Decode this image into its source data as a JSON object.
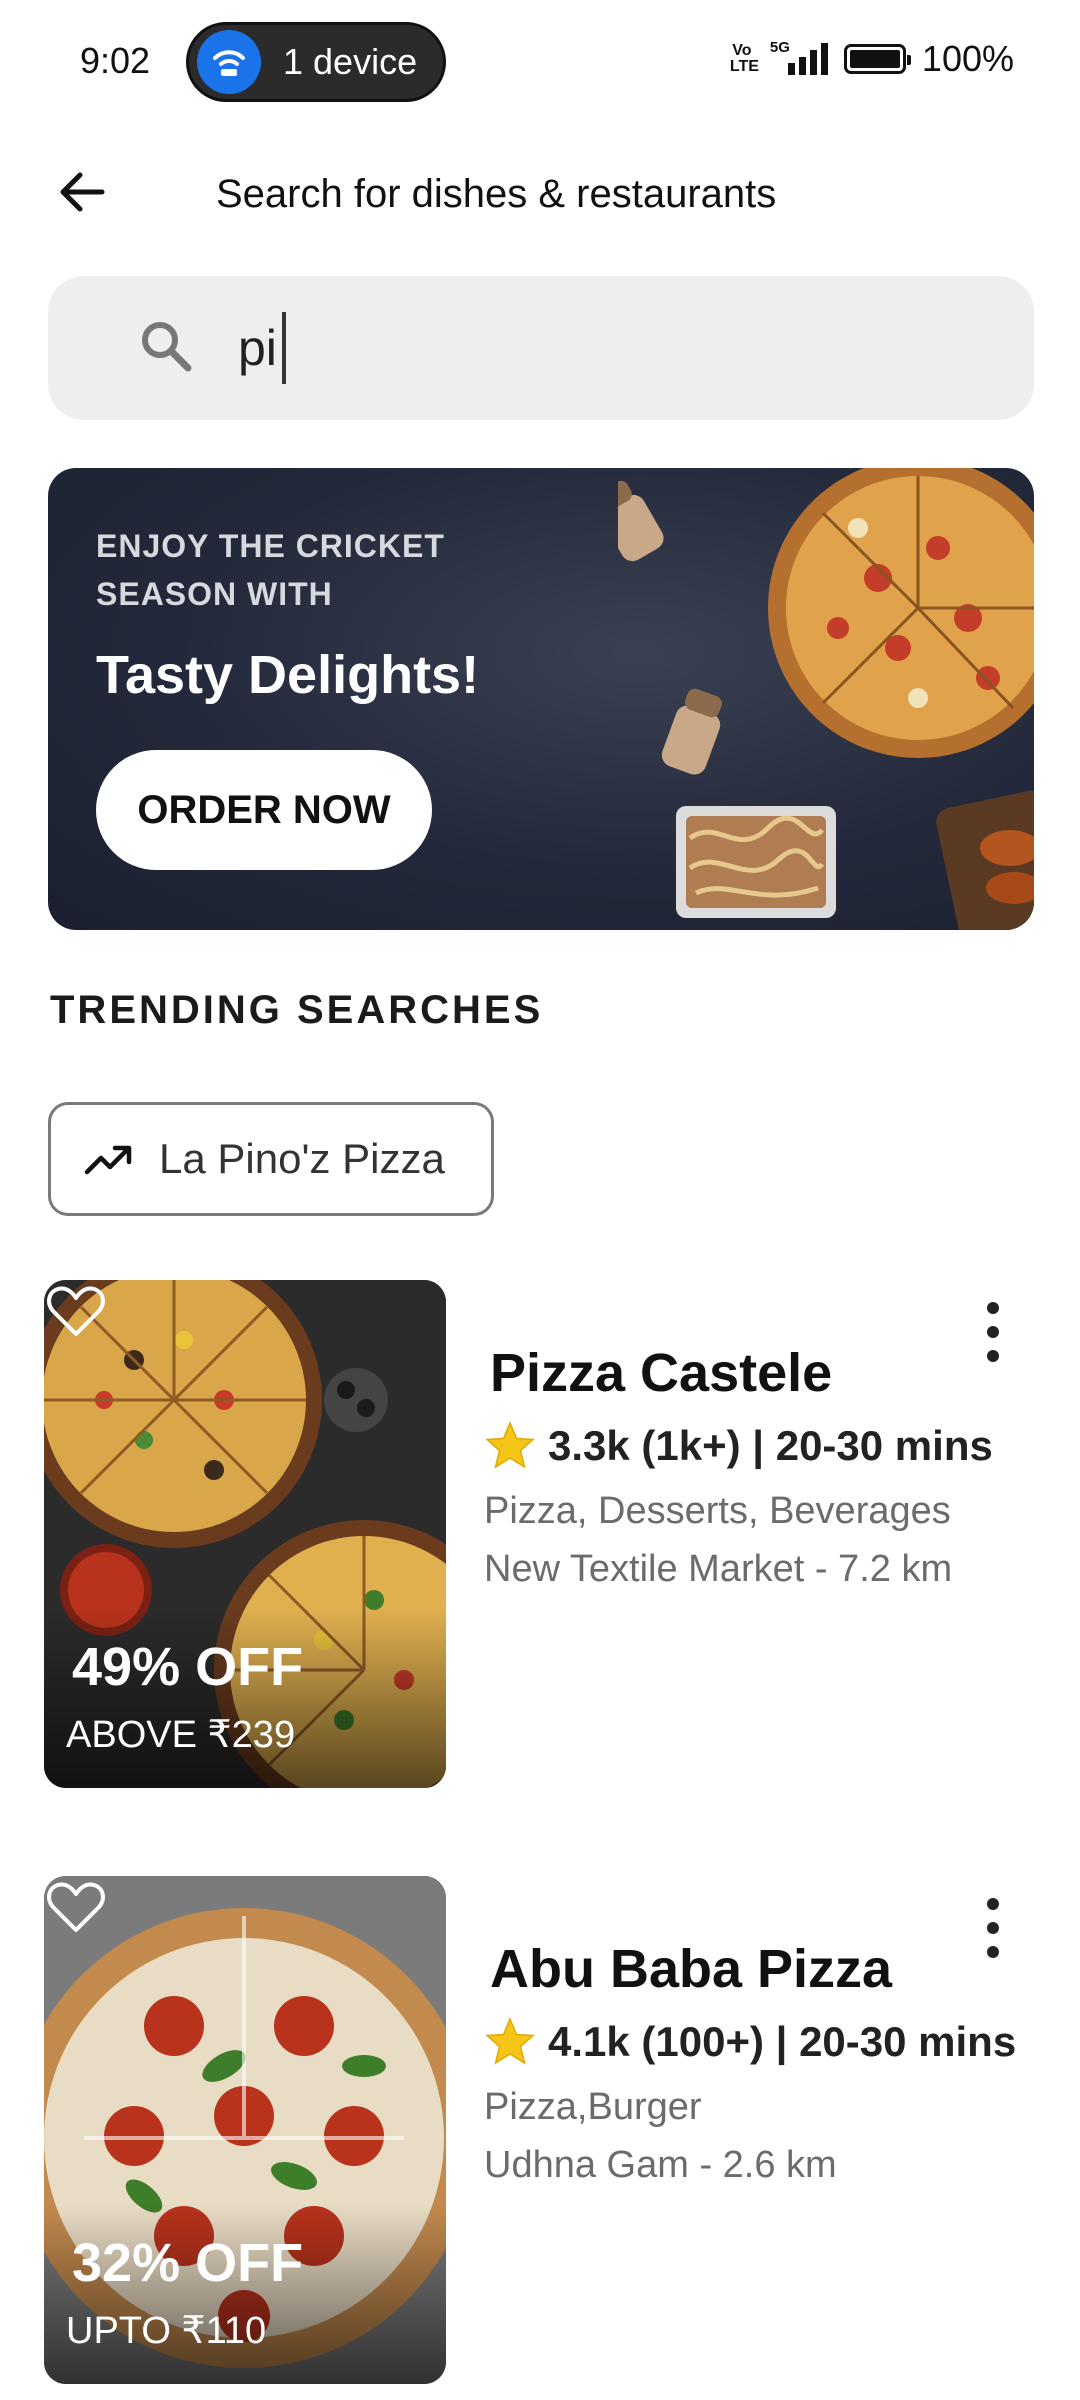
{
  "status_bar": {
    "time": "9:02",
    "device_pill": "1 device",
    "volte": "Vo LTE",
    "network": "5G",
    "battery": "100%"
  },
  "header": {
    "title": "Search for dishes & restaurants"
  },
  "search": {
    "value": "pi"
  },
  "banner": {
    "eyebrow": "ENJOY THE CRICKET SEASON WITH",
    "title": "Tasty Delights!",
    "cta_label": "ORDER NOW"
  },
  "trending": {
    "heading": "TRENDING SEARCHES",
    "chips": [
      {
        "label": "La Pino'z Pizza",
        "icon": "trending-up-icon"
      }
    ]
  },
  "restaurants": [
    {
      "name": "Pizza Castele",
      "rating": "3.3k (1k+) | 20-30 mins",
      "cuisine": "Pizza, Desserts, Beverages",
      "location": "New Textile Market - 7.2 km",
      "offer": "49% OFF",
      "offer_sub": "ABOVE ₹239"
    },
    {
      "name": "Abu Baba Pizza",
      "rating": "4.1k (100+) | 20-30 mins",
      "cuisine": "Pizza,Burger",
      "location": "Udhna Gam - 2.6 km",
      "offer": "32% OFF",
      "offer_sub": "UPTO ₹110"
    }
  ],
  "colors": {
    "accent_blue": "#1a73e8",
    "banner_bg": "#23293a",
    "star": "#f5c518",
    "muted_text": "#6b6b6b"
  }
}
